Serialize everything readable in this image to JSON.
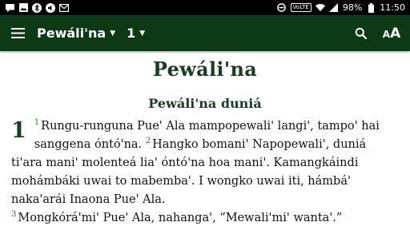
{
  "status_bar": {
    "time": "11:50",
    "battery": "98%",
    "network": "VoLTE",
    "left_icons": [
      "message-icon",
      "image-icon",
      "bluetooth-icon",
      "sound-icon",
      "gmail-icon"
    ],
    "right_icons": [
      "block-icon",
      "volte-icon",
      "wifi-icon",
      "signal-icon",
      "battery-icon"
    ]
  },
  "toolbar": {
    "book": "Pewáli'na",
    "chapter": "1",
    "background": "#0c3a14"
  },
  "content": {
    "book_title": "Pewáli'na",
    "section_heading": "Pewáli'na duniá",
    "chapter_number": "1",
    "verse1_num": "1",
    "verse1_text": "Rungu-runguna Pue' Ala mampopewali' langi', tampo' hai sanggena óntó'na. ",
    "verse2_num": "2",
    "verse2_text": "Hangko bomani' Napopewali', duniá ti'ara mani' molenteá lia' óntó'na hoa mani'. Kamangkáindi mohámbáki uwai to mabemba'. I wongko uwai iti, hámbá' naka'arái Inaona Pue' Ala.",
    "verse3_num": "3",
    "verse3_text": "Mongkórá'mi' Pue' Ala, nahanga', “Mewali'mi' wanta'.”",
    "accent_color": "#163f22"
  }
}
